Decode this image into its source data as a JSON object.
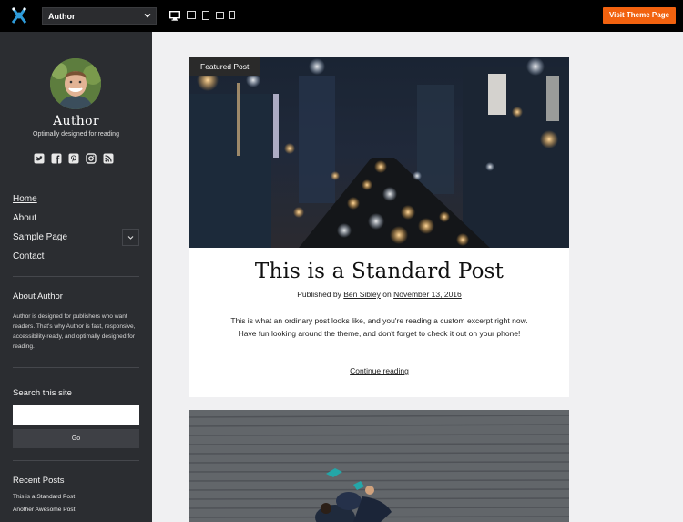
{
  "topbar": {
    "theme_select_value": "Author",
    "visit_button_label": "Visit Theme Page",
    "device_icons": [
      "desktop-icon",
      "laptop-icon",
      "tablet-icon",
      "tablet-small-icon",
      "phone-icon"
    ]
  },
  "sidebar": {
    "site_title": "Author",
    "tagline": "Optimally designed for reading",
    "social_icons": [
      "twitter-icon",
      "facebook-icon",
      "pinterest-icon",
      "instagram-icon",
      "rss-icon"
    ],
    "nav": [
      {
        "label": "Home",
        "active": true
      },
      {
        "label": "About",
        "active": false
      },
      {
        "label": "Sample Page",
        "active": false,
        "has_submenu": true
      },
      {
        "label": "Contact",
        "active": false
      }
    ],
    "about_widget": {
      "title": "About Author",
      "text": "Author is designed for publishers who want readers. That's why Author is fast, responsive, accessibility-ready, and optimally designed for reading."
    },
    "search_widget": {
      "title": "Search this site",
      "button_label": "Go"
    },
    "recent_posts": {
      "title": "Recent Posts",
      "items": [
        "This is a Standard Post",
        "Another Awesome Post"
      ]
    }
  },
  "post": {
    "label": "Featured Post",
    "title": "This is a Standard Post",
    "meta_prefix": "Published by",
    "author": "Ben Sibley",
    "meta_on": "on",
    "date": "November 13, 2016",
    "excerpt": "This is what an ordinary post looks like, and you're reading a custom excerpt right now. Have fun looking around the theme, and don't forget to check it out on your phone!",
    "continue_label": "Continue reading"
  },
  "colors": {
    "topbar_bg": "#000000",
    "accent": "#f2620f",
    "sidebar_bg": "#2b2d31",
    "content_bg": "#f0f0f2"
  }
}
